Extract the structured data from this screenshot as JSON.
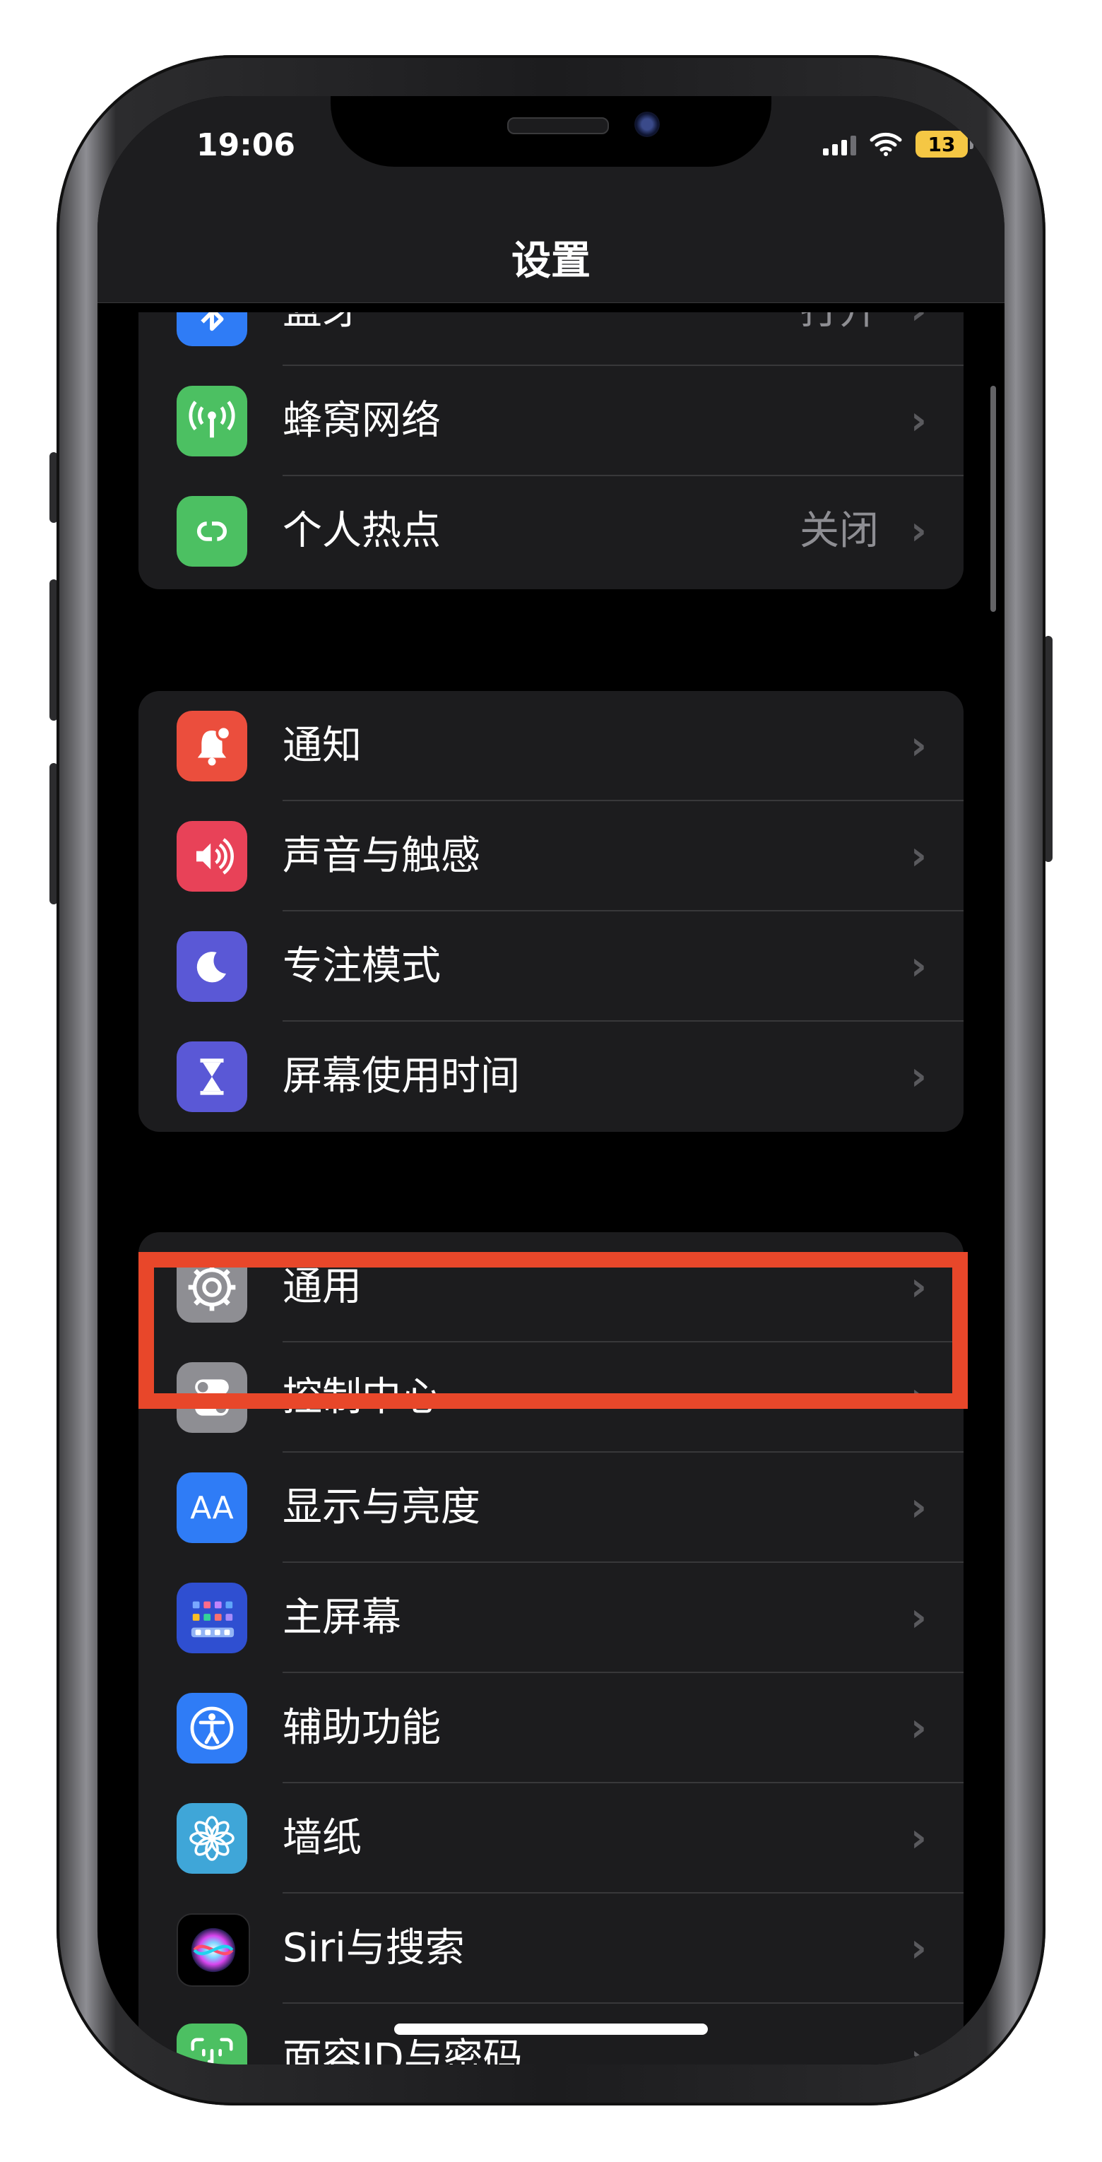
{
  "status_bar": {
    "time": "19:06",
    "battery": "13",
    "battery_color": "#f5c744"
  },
  "nav": {
    "title": "设置"
  },
  "group1": [
    {
      "label": "蓝牙",
      "value": "打开",
      "icon": "bluetooth-icon",
      "color": "#2f7cf6"
    },
    {
      "label": "蜂窝网络",
      "value": "",
      "icon": "cellular-icon",
      "color": "#4cc062"
    },
    {
      "label": "个人热点",
      "value": "关闭",
      "icon": "hotspot-icon",
      "color": "#4cc062"
    }
  ],
  "group2": [
    {
      "label": "通知",
      "icon": "notification-bell-icon",
      "color": "#eb4e3d"
    },
    {
      "label": "声音与触感",
      "icon": "speaker-icon",
      "color": "#e84258"
    },
    {
      "label": "专注模式",
      "icon": "moon-icon",
      "color": "#5a58d6"
    },
    {
      "label": "屏幕使用时间",
      "icon": "hourglass-icon",
      "color": "#5a58d6"
    }
  ],
  "group3": [
    {
      "label": "通用",
      "icon": "gear-icon",
      "color": "#8e8e93"
    },
    {
      "label": "控制中心",
      "icon": "toggles-icon",
      "color": "#8e8e93"
    },
    {
      "label": "显示与亮度",
      "icon": "display-aa-icon",
      "glyph": "AA",
      "color": "#2f7cf6"
    },
    {
      "label": "主屏幕",
      "icon": "home-screen-grid-icon",
      "color": "#2f4fd1"
    },
    {
      "label": "辅助功能",
      "icon": "accessibility-icon",
      "color": "#2f7cf6"
    },
    {
      "label": "墙纸",
      "icon": "wallpaper-flower-icon",
      "color": "#3fa6d8"
    },
    {
      "label": "Siri与搜索",
      "icon": "siri-icon",
      "color": "#1c1c1e"
    },
    {
      "label": "面容ID与密码",
      "icon": "face-id-icon",
      "color": "#4cc062"
    }
  ],
  "highlight_color": "#e8472a"
}
